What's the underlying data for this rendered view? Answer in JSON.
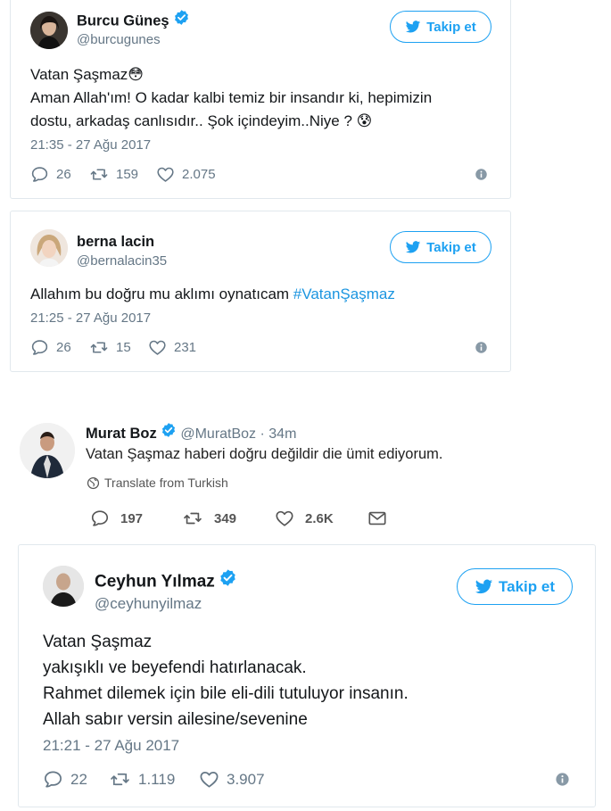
{
  "tweets": [
    {
      "name": "Burcu Güneş",
      "handle": "@burcugunes",
      "follow_label": "Takip et",
      "lines": [
        "Vatan Şaşmaz😳",
        "Aman Allah'ım! O kadar kalbi temiz bir insandır ki, hepimizin",
        "dostu, arkadaş canlısıdır.. Şok içindeyim..Niye ? 😰"
      ],
      "date": "21:35 - 27 Ağu 2017",
      "replies": "26",
      "retweets": "159",
      "likes": "2.075"
    },
    {
      "name": "berna lacin",
      "handle": "@bernalacin35",
      "follow_label": "Takip et",
      "text_before": "Allahım bu doğru mu aklımı oynatıcam ",
      "hashtag": "#VatanŞaşmaz",
      "date": "21:25 - 27 Ağu 2017",
      "replies": "26",
      "retweets": "15",
      "likes": "231"
    },
    {
      "name": "Murat Boz",
      "handle_time": "@MuratBoz · 34m",
      "text": "Vatan Şaşmaz haberi doğru değildir die ümit ediyorum.",
      "translate": "Translate from Turkish",
      "replies": "197",
      "retweets": "349",
      "likes": "2.6K"
    },
    {
      "name": "Ceyhun Yılmaz",
      "handle": "@ceyhunyilmaz",
      "follow_label": "Takip et",
      "lines": [
        "Vatan Şaşmaz",
        "yakışıklı ve beyefendi hatırlanacak.",
        "Rahmet dilemek için bile eli-dili tutuluyor insanın.",
        "Allah sabır versin ailesine/sevenine"
      ],
      "date": "21:21 - 27 Ağu 2017",
      "replies": "22",
      "retweets": "1.119",
      "likes": "3.907"
    }
  ],
  "icons": {
    "reply": "speech-bubble-icon",
    "retweet": "retweet-arrows-icon",
    "like": "heart-icon",
    "info": "info-circle-icon",
    "verified": "verified-badge-icon",
    "bird": "twitter-bird-icon",
    "globe": "globe-icon",
    "dm": "envelope-icon"
  },
  "colors": {
    "accent": "#1da1f2",
    "muted": "#657786",
    "border": "#e1e8ed",
    "hashtag": "#1b95e0"
  }
}
